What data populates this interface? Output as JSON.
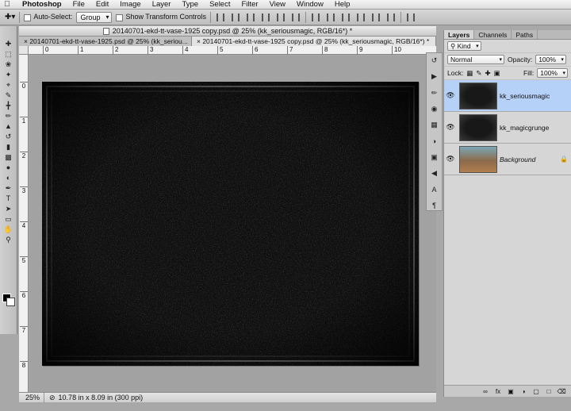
{
  "menubar": {
    "app_name": "Photoshop",
    "items": [
      "File",
      "Edit",
      "Image",
      "Layer",
      "Type",
      "Select",
      "Filter",
      "View",
      "Window",
      "Help"
    ]
  },
  "options_bar": {
    "auto_select_label": "Auto-Select:",
    "auto_select_value": "Group",
    "show_transform_label": "Show Transform Controls"
  },
  "document": {
    "window_title": "20140701-ekd-tt-vase-1925 copy.psd @ 25% (kk_seriousmagic, RGB/16*) *",
    "tabs": [
      {
        "label": "20140701-ekd-tt-vase-1925.psd @ 25% (kk_seriou...",
        "active": false
      },
      {
        "label": "20140701-ekd-tt-vase-1925 copy.psd @ 25% (kk_seriousmagic, RGB/16*) *",
        "active": true
      }
    ],
    "ruler_marks": [
      "0",
      "1",
      "2",
      "3",
      "4",
      "5",
      "6",
      "7",
      "8",
      "9",
      "10"
    ],
    "ruler_v_marks": [
      "0",
      "1",
      "2",
      "3",
      "4",
      "5",
      "6",
      "7",
      "8"
    ]
  },
  "status": {
    "zoom": "25%",
    "doc_info": "10.78 in x 8.09 in (300 ppi)"
  },
  "layers_panel": {
    "tabs": [
      "Layers",
      "Channels",
      "Paths"
    ],
    "filter_label": "Kind",
    "blend_mode": "Normal",
    "opacity_label": "Opacity:",
    "opacity_value": "100%",
    "lock_label": "Lock:",
    "fill_label": "Fill:",
    "fill_value": "100%",
    "layers": [
      {
        "name": "kk_seriousmagic",
        "selected": true,
        "thumb": "dark"
      },
      {
        "name": "kk_magicgrunge",
        "selected": false,
        "thumb": "dark"
      },
      {
        "name": "Background",
        "selected": false,
        "thumb": "photo",
        "locked": true
      }
    ],
    "footer_icons": [
      "link-icon",
      "fx-icon",
      "mask-icon",
      "adjustment-icon",
      "folder-icon",
      "new-layer-icon",
      "trash-icon"
    ],
    "fx_label": "fx"
  },
  "tools": [
    "move",
    "marquee",
    "lasso",
    "quick-select",
    "crop",
    "eyedropper",
    "healing",
    "brush",
    "stamp",
    "history-brush",
    "eraser",
    "gradient",
    "blur",
    "dodge",
    "pen",
    "type",
    "path-select",
    "shape",
    "hand",
    "zoom"
  ]
}
